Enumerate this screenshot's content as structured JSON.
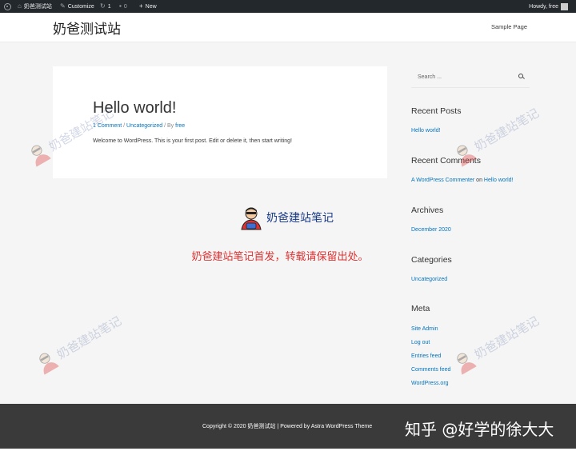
{
  "adminbar": {
    "site_name": "奶爸测试站",
    "customize": "Customize",
    "updates_count": "1",
    "comments_count": "0",
    "new_label": "New",
    "howdy": "Howdy, free"
  },
  "header": {
    "site_title": "奶爸测试站",
    "nav": [
      "Sample Page"
    ]
  },
  "post": {
    "title": "Hello world!",
    "meta_comments": "1 Comment",
    "meta_sep1": " / ",
    "meta_category": "Uncategorized",
    "meta_sep2": " / By ",
    "meta_author": "free",
    "excerpt": "Welcome to WordPress. This is your first post. Edit or delete it, then start writing!"
  },
  "watermark": {
    "brand": "奶爸建站笔记",
    "note": "奶爸建站笔记首发，转载请保留出处。",
    "zhihu": "知乎 @好学的徐大大"
  },
  "sidebar": {
    "search_placeholder": "Search ...",
    "recent_posts_title": "Recent Posts",
    "recent_posts": [
      "Hello world!"
    ],
    "recent_comments_title": "Recent Comments",
    "comment_author": "A WordPress Commenter",
    "comment_on": " on ",
    "comment_post": "Hello world!",
    "archives_title": "Archives",
    "archives": [
      "December 2020"
    ],
    "categories_title": "Categories",
    "categories": [
      "Uncategorized"
    ],
    "meta_title": "Meta",
    "meta_links": [
      "Site Admin",
      "Log out",
      "Entries feed",
      "Comments feed",
      "WordPress.org"
    ]
  },
  "footer": {
    "copyright": "Copyright © 2020 ",
    "site": "奶爸测试站",
    "powered": " | Powered by ",
    "theme": "Astra WordPress Theme"
  },
  "colors": {
    "admin_bar": "#23282d",
    "link": "#0274be",
    "footer": "#3a3a3a",
    "watermark_red": "#dd3333"
  }
}
